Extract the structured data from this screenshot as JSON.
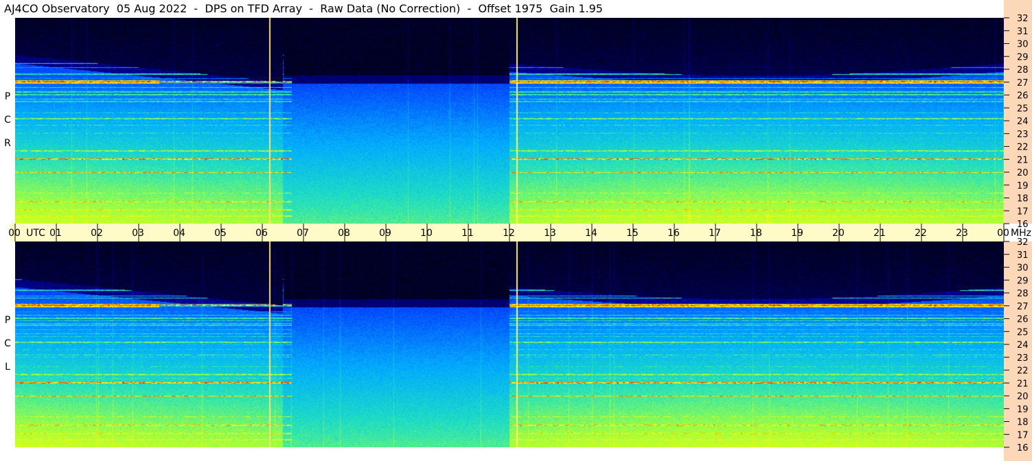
{
  "title": "AJ4CO Observatory  05 Aug 2022  -  DPS on TFD Array  -  Raw Data (No Correction)  -  Offset 1975  Gain 1.95",
  "chart_data": {
    "type": "heatmap",
    "title": "AJ4CO Observatory  05 Aug 2022  -  DPS on TFD Array  -  Raw Data (No Correction)  -  Offset 1975  Gain 1.95",
    "colormap": [
      "#000014",
      "#00008c",
      "#0046ff",
      "#00aaff",
      "#20e0c0",
      "#a0ff40",
      "#ffff00",
      "#ff8000",
      "#ff0000",
      "#ffffff"
    ],
    "panels": [
      {
        "name": "RCP",
        "label_letters": [
          "P",
          "C",
          "R"
        ]
      },
      {
        "name": "LCP",
        "label_letters": [
          "P",
          "C",
          "L"
        ]
      }
    ],
    "x_axis": {
      "ticks": [
        "00",
        "01",
        "02",
        "03",
        "04",
        "05",
        "06",
        "07",
        "08",
        "09",
        "10",
        "11",
        "12",
        "13",
        "14",
        "15",
        "16",
        "17",
        "18",
        "19",
        "20",
        "21",
        "22",
        "23",
        "00"
      ],
      "unit": "UTC",
      "range_hours": [
        0,
        24
      ]
    },
    "y_axis": {
      "ticks": [
        "32",
        "31",
        "30",
        "29",
        "28",
        "27",
        "26",
        "25",
        "24",
        "23",
        "22",
        "21",
        "20",
        "19",
        "18",
        "17",
        "16"
      ],
      "unit": "MHz",
      "range_mhz": [
        16,
        32
      ]
    },
    "vertical_markers_utc": [
      6.17,
      12.17
    ],
    "vertical_marker_colors": [
      "#ffe070",
      "#fff070"
    ],
    "persistent_carriers_mhz": [
      27.05,
      21.05,
      20.0,
      17.75,
      17.1,
      16.6,
      18.4,
      21.7,
      24.2,
      26.05,
      25.5
    ],
    "night_weak_hours": [
      6.5,
      12.0
    ]
  }
}
